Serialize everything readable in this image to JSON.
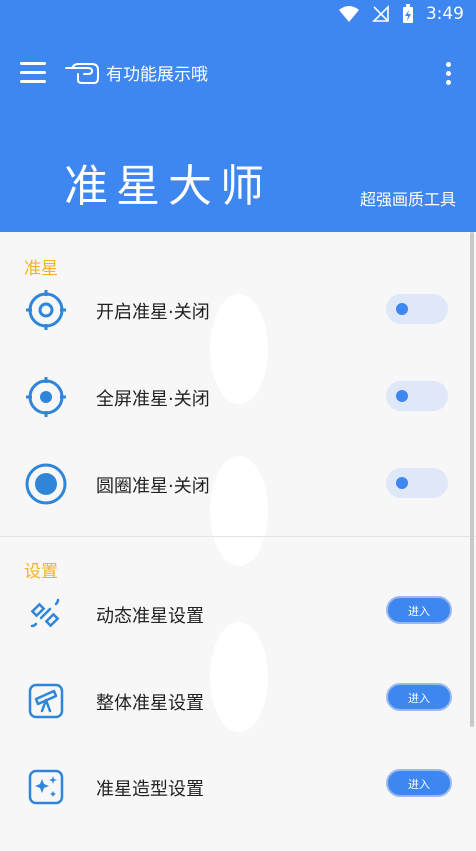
{
  "status_bar": {
    "time": "3:49",
    "wifi_icon": "wifi-icon",
    "signal_icon": "no-signal-icon",
    "battery_icon": "battery-charging-icon"
  },
  "header": {
    "title": "有功能展示哦",
    "brand": "准星大师",
    "brand_sub": "超强画质工具"
  },
  "sections": {
    "crosshair": {
      "title": "准星",
      "items": [
        {
          "label": "开启准星·关闭",
          "icon": "crosshair-ring-icon"
        },
        {
          "label": "全屏准星·关闭",
          "icon": "crosshair-filled-icon"
        },
        {
          "label": "圆圈准星·关闭",
          "icon": "circle-dot-icon"
        }
      ]
    },
    "settings": {
      "title": "设置",
      "items": [
        {
          "label": "动态准星设置",
          "button": "进入",
          "icon": "satellite-icon"
        },
        {
          "label": "整体准星设置",
          "button": "进入",
          "icon": "telescope-icon"
        },
        {
          "label": "准星造型设置",
          "button": "进入",
          "icon": "sparkle-icon"
        }
      ]
    }
  },
  "colors": {
    "primary": "#3e87f0",
    "section_title": "#f2b31c",
    "background": "#f7f7f7"
  }
}
